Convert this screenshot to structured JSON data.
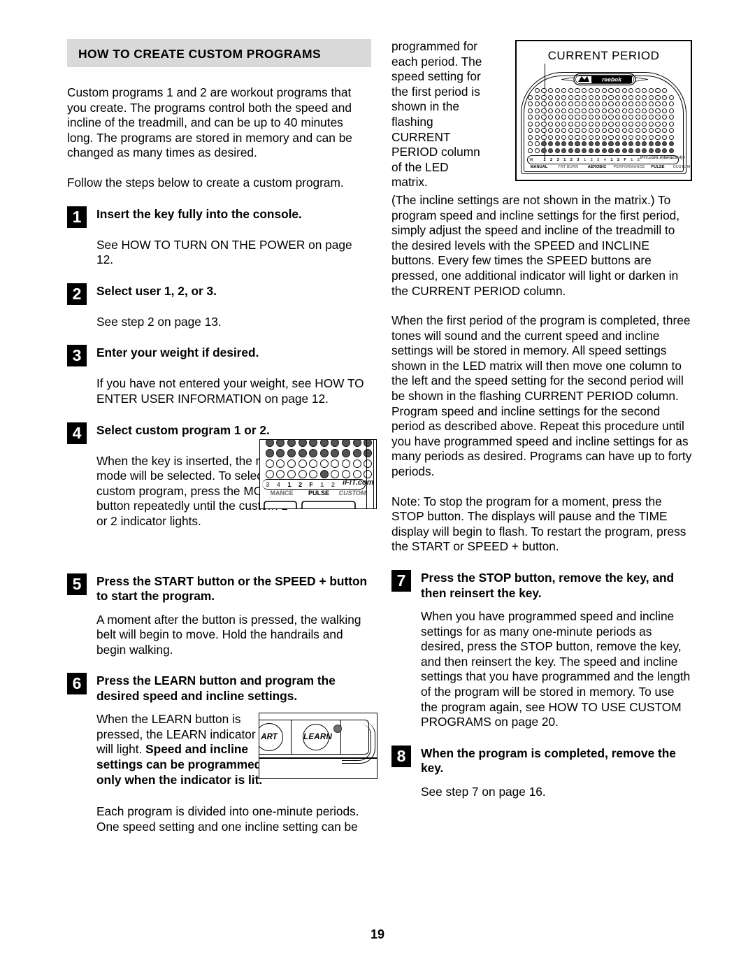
{
  "page": {
    "number": "19"
  },
  "section": {
    "header": "HOW TO CREATE CUSTOM PROGRAMS"
  },
  "left_column": {
    "intro_paragraph": "Custom programs 1 and 2 are workout programs that you create. The programs control both the speed and incline of the treadmill, and can be up to 40 minutes long. The programs are stored in memory and can be changed as many times as desired.",
    "follow_paragraph": "Follow the steps below to create a custom program.",
    "steps": [
      {
        "number": "1",
        "title": "Insert the key fully into the console.",
        "body": "See HOW TO TURN ON THE POWER on page 12."
      },
      {
        "number": "2",
        "title": "Select user 1, 2, or 3.",
        "body": "See step 2 on page 13."
      },
      {
        "number": "3",
        "title": "Enter your weight if desired.",
        "body": "If you have not entered your weight, see HOW TO ENTER USER INFORMATION on page 12."
      },
      {
        "number": "4",
        "title": "Select custom program 1 or 2.",
        "body": "When the key is inserted, the manual mode will be selected. To select a custom program, press the MODE button repeatedly until the custom 1 or 2 indicator lights."
      },
      {
        "number": "5",
        "title": "Press the START button or the SPEED + button to start the program.",
        "body": "A moment after the button is pressed, the walking belt will begin to move. Hold the handrails and begin walking."
      },
      {
        "number": "6",
        "title": "Press the LEARN button and program the desired speed and incline settings.",
        "body_part1": "When the LEARN button is pressed, the LEARN indicator will light. ",
        "body_bold": "Speed and incline settings can be programmed only when the indicator is lit.",
        "closing_paragraph": "Each program is divided into one-minute periods. One speed setting and one incline setting can be"
      }
    ]
  },
  "right_column": {
    "continued_paragraph": "programmed for each period. The speed setting for the first period is shown in the flashing CURRENT PERIOD column of the LED matrix.",
    "paragraph_2": "(The incline settings are not shown in the matrix.) To program speed and incline settings for the first period, simply adjust the speed and incline of the treadmill to the desired levels with the SPEED and INCLINE buttons. Every few times the SPEED buttons are pressed, one additional indicator will light or darken in the CURRENT PERIOD column.",
    "paragraph_3": "When the first period of the program is completed, three tones will sound and the current speed and incline settings will be stored in memory. All speed settings shown in the LED matrix will then move one column to the left and the speed setting for the second period will be shown in the flashing CURRENT PERIOD column. Program speed and incline settings for the second period as described above. Repeat this procedure until you have programmed speed and incline settings for as many periods as desired. Programs can have up to forty periods.",
    "note_paragraph": "Note: To stop the program for a moment, press the STOP button. The displays will pause and the TIME display will begin to flash. To restart the program, press the START or SPEED + button.",
    "steps": [
      {
        "number": "7",
        "title": "Press the STOP button, remove the key, and then reinsert the key.",
        "body": "When you have programmed speed and incline settings for as many one-minute periods as desired, press the STOP button, remove the key, and then reinsert the key. The speed and incline settings that you have programmed and the length of the program will be stored in memory. To use the program again, see HOW TO USE CUSTOM PROGRAMS on page 20."
      },
      {
        "number": "8",
        "title": "When the program is completed, remove the key.",
        "body": "See step 7 on page 16."
      }
    ]
  },
  "figure_current_period": {
    "caption": "CURRENT PERIOD",
    "brand": "reebok",
    "zone_numbers": [
      "M",
      "",
      "1",
      "2",
      "3",
      "1",
      "2",
      "3",
      "1",
      "2",
      "3",
      "4",
      "1",
      "2",
      "F",
      "1",
      "2"
    ],
    "zone_names": [
      "MANUAL",
      "FAT BURN",
      "AEROBIC",
      "PERFORMANCE",
      "PULSE",
      "CUSTOM"
    ],
    "ifit_label": "iFIT.com interactivity",
    "matrix_rows": 10,
    "matrix_cols": 22,
    "lit_rows_from_bottom": 2
  },
  "figure_step4_console": {
    "zone_numbers": [
      "3",
      "4",
      "1",
      "2",
      "F",
      "1",
      "2"
    ],
    "zone_names": [
      "MANCE",
      "PULSE",
      "CUSTOM"
    ],
    "ifit_label": "iFIT.com"
  },
  "figure_learn_button": {
    "start_label": "ART",
    "learn_label": "LEARN",
    "indicator_name": "learn-indicator-light"
  },
  "colors": {
    "header_background": "#d9d9d9",
    "text": "#000000",
    "step_badge_background": "#000000",
    "led_on": "#555555",
    "page_background": "#ffffff"
  }
}
